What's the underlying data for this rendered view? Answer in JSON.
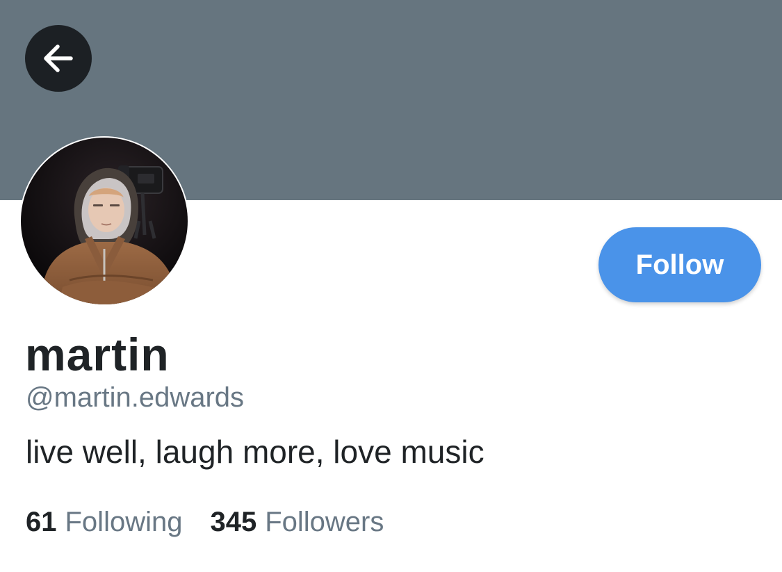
{
  "colors": {
    "banner": "#66757f",
    "back_button_bg": "#1c2024",
    "accent": "#4a93e9",
    "text_primary": "#1f2326",
    "text_secondary": "#687784"
  },
  "header": {
    "back_icon": "arrow-left-icon"
  },
  "profile": {
    "avatar": "profile-photo",
    "name": "martin",
    "handle": "@martin.edwards",
    "bio": "live well, laugh more, love music",
    "follow_label": "Follow"
  },
  "stats": {
    "following_count": "61",
    "following_label": "Following",
    "followers_count": "345",
    "followers_label": "Followers"
  }
}
